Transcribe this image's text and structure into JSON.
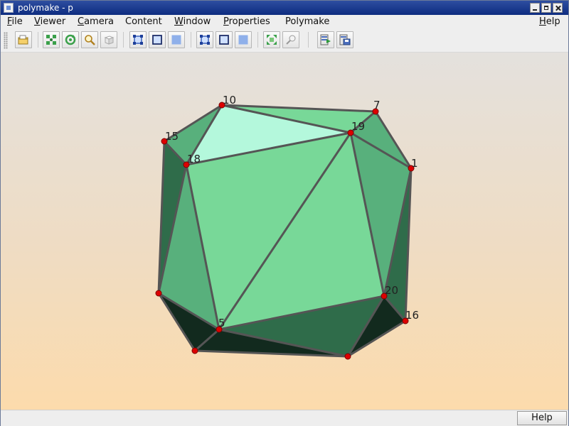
{
  "window": {
    "title": "polymake - p"
  },
  "menu": {
    "items": [
      {
        "label": "File",
        "mnemonic": "F",
        "rest": "ile"
      },
      {
        "label": "Viewer",
        "mnemonic": "V",
        "rest": "iewer"
      },
      {
        "label": "Camera",
        "mnemonic": "C",
        "rest": "amera"
      },
      {
        "label": "Content",
        "mnemonic": "",
        "rest": "Content"
      },
      {
        "label": "Window",
        "mnemonic": "W",
        "rest": "indow"
      },
      {
        "label": "Properties",
        "mnemonic": "P",
        "rest": "roperties"
      },
      {
        "label": "Polymake",
        "mnemonic": "",
        "rest": "Polymake"
      }
    ],
    "help": {
      "label": "Help",
      "mnemonic": "H",
      "rest": "elp"
    }
  },
  "toolbar": {
    "buttons": [
      {
        "name": "open-folder-icon"
      },
      {
        "name": "fit-to-screen-icon"
      },
      {
        "name": "rotate-icon"
      },
      {
        "name": "zoom-icon"
      },
      {
        "name": "cube-icon"
      },
      {
        "name": "select-vertices-icon"
      },
      {
        "name": "select-edges-icon"
      },
      {
        "name": "select-faces-icon"
      },
      {
        "name": "show-vertices-icon"
      },
      {
        "name": "show-edges-icon"
      },
      {
        "name": "show-faces-icon"
      },
      {
        "name": "explode-icon"
      },
      {
        "name": "light-icon"
      },
      {
        "name": "export-icon"
      },
      {
        "name": "save-image-icon"
      }
    ]
  },
  "polytope": {
    "vertex_labels": [
      "10",
      "7",
      "15",
      "19",
      "18",
      "1",
      "20",
      "16",
      "5"
    ],
    "colors": {
      "face_light": "#78d898",
      "face_top": "#b4f8dc",
      "face_mid": "#58b07c",
      "face_dark": "#2f6c4a",
      "face_darkest": "#122a1e",
      "edge": "#555555",
      "vertex": "#dd0000"
    }
  },
  "statusbar": {
    "help_label": "Help"
  }
}
